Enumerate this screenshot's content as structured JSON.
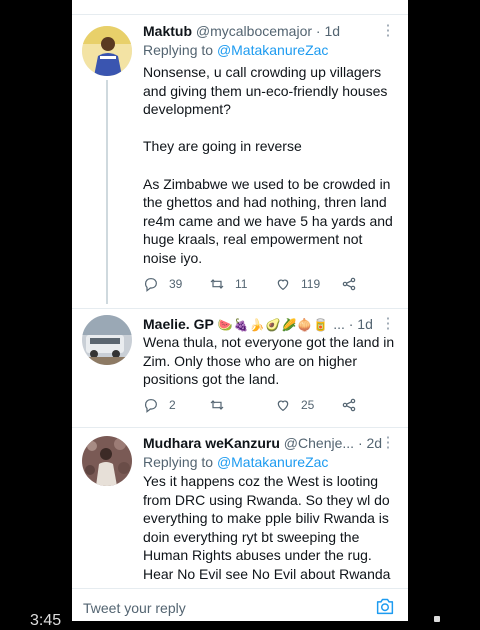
{
  "tweets": [
    {
      "name": "Maktub",
      "handle": "@mycalbocemajor",
      "time": "· 1d",
      "replying_prefix": "Replying to ",
      "replying_to": "@MatakanureZac",
      "body": "Nonsense, u call crowding up villagers and giving them un-eco-friendly houses development?\n\nThey are going in reverse\n\nAs Zimbabwe we used to be crowded in the ghettos and had nothing, thren land re4m came and we have 5 ha yards and huge kraals, real empowerment not noise iyo.",
      "replies": "39",
      "retweets": "11",
      "likes": "119"
    },
    {
      "name": "Maelie. GP",
      "emojis": "🍉🍇🍌🥑🌽🧅🥫",
      "ellipsis": "...",
      "time": "· 1d",
      "body": "Wena thula, not everyone got the land in Zim. Only those who are on higher positions got the land.",
      "replies": "2",
      "retweets": "",
      "likes": "25"
    },
    {
      "name": "Mudhara weKanzuru",
      "handle": "@Chenje...",
      "time": "· 2d",
      "replying_prefix": "Replying to ",
      "replying_to": "@MatakanureZac",
      "body": "Yes it happens coz the West is looting from DRC using Rwanda. So they wl do everything to make pple biliv Rwanda is doin everything ryt bt sweeping the Human Rights abuses under the rug. Hear No Evil see No Evil about Rwanda"
    }
  ],
  "reply_bar": {
    "placeholder": "Tweet your reply"
  },
  "corner": {
    "left_text": "3:45"
  },
  "colors": {
    "link": "#1d9bf0",
    "muted": "#536471",
    "divider": "#e6ecf0"
  }
}
